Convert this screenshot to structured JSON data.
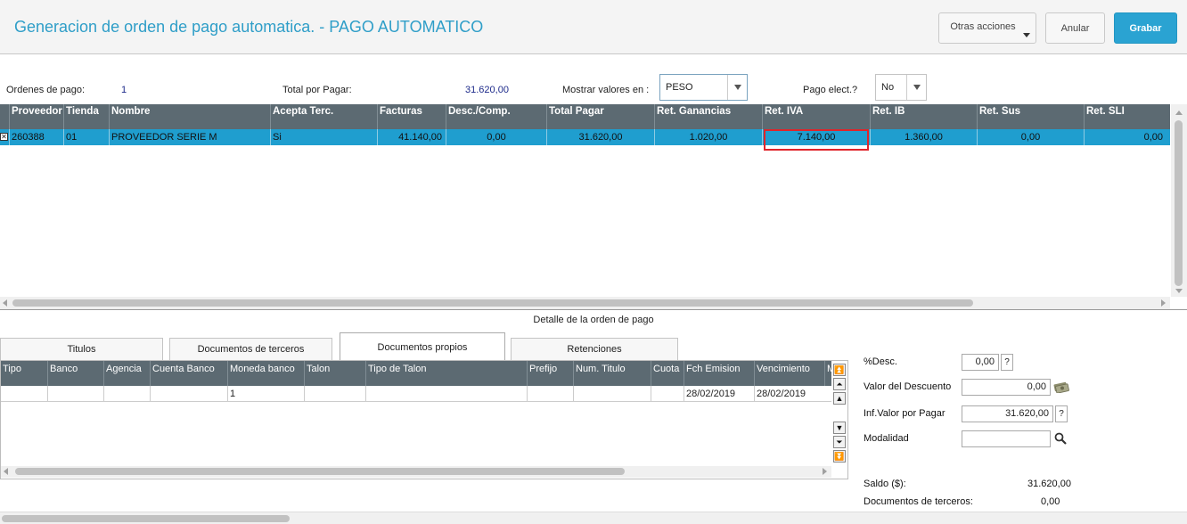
{
  "header": {
    "title": "Generacion de orden de pago automatica. - PAGO AUTOMATICO",
    "buttons": {
      "otras": "Otras acciones",
      "anular": "Anular",
      "grabar": "Grabar"
    }
  },
  "summary": {
    "ordenes_label": "Ordenes de pago:",
    "ordenes_value": "1",
    "total_label": "Total por Pagar:",
    "total_value": "31.620,00",
    "mostrar_label": "Mostrar valores en :",
    "mostrar_value": "PESO",
    "pago_label": "Pago elect.?",
    "pago_value": "No"
  },
  "main_grid": {
    "columns": [
      "Proveedor",
      "Tienda",
      "Nombre",
      "Acepta Terc.",
      "Facturas",
      "Desc./Comp.",
      "Total Pagar",
      "Ret. Ganancias",
      "Ret. IVA",
      "Ret. IB",
      "Ret. Sus",
      "Ret. SLI"
    ],
    "row": {
      "check": "✕",
      "proveedor": "260388",
      "tienda": "01",
      "nombre": "PROVEEDOR SERIE M",
      "acepta": "Si",
      "facturas": "41.140,00",
      "desc": "0,00",
      "total": "31.620,00",
      "ret_gan": "1.020,00",
      "ret_iva": "7.140,00",
      "ret_ib": "1.360,00",
      "ret_sus": "0,00",
      "ret_sli": "0,00"
    }
  },
  "detail": {
    "title": "Detalle de la orden de pago",
    "tabs": [
      "Titulos",
      "Documentos de terceros",
      "Documentos propios",
      "Retenciones"
    ],
    "columns": [
      "Tipo",
      "Banco",
      "Agencia",
      "Cuenta Banco",
      "Moneda banco",
      "Talon",
      "Tipo de Talon",
      "Prefijo",
      "Num. Titulo",
      "Cuota",
      "Fch Emision",
      "Vencimiento",
      "M"
    ],
    "row": {
      "moneda": "1",
      "emision": "28/02/2019",
      "vencimiento": "28/02/2019"
    }
  },
  "right_panel": {
    "desc_label": "%Desc.",
    "desc_value": "0,00",
    "valor_desc_label": "Valor del Descuento",
    "valor_desc_value": "0,00",
    "inf_valor_label": "Inf.Valor por Pagar",
    "inf_valor_value": "31.620,00",
    "modalidad_label": "Modalidad",
    "modalidad_value": "",
    "saldo_label": "Saldo ($):",
    "saldo_value": "31.620,00",
    "doc_terc_label": "Documentos de terceros:",
    "doc_terc_value": "0,00",
    "help": "?"
  },
  "icons": [
    "chevron-down-icon",
    "search-icon",
    "money-icon",
    "scroll-arrow-icon"
  ]
}
